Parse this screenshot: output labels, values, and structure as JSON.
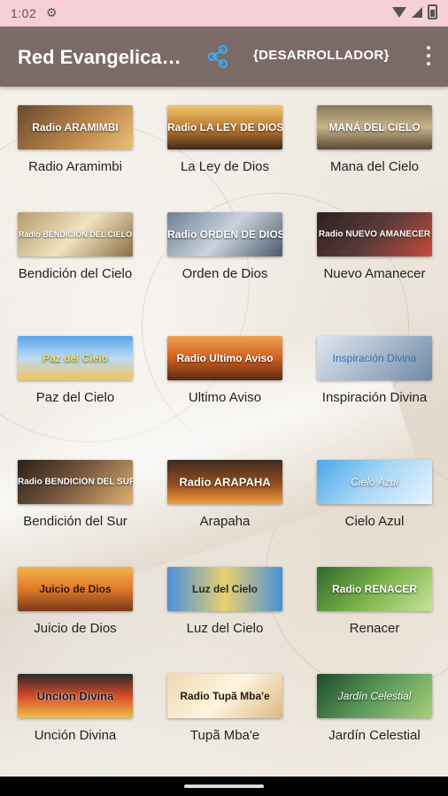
{
  "status_bar": {
    "time": "1:02"
  },
  "app_bar": {
    "title": "Red Evangelica Radial",
    "developer_label": "{DESARROLLADOR}"
  },
  "colors": {
    "app_bar": "#7b6a66",
    "status_bar": "#f6cfd9",
    "share_icon": "#3fa9f5"
  },
  "stations": [
    {
      "name": "Radio Aramimbi",
      "thumb_text": "Radio ARAMIMBI"
    },
    {
      "name": "La Ley de Dios",
      "thumb_text": "Radio LA LEY DE DIOS"
    },
    {
      "name": "Mana del Cielo",
      "thumb_text": "MANÁ DEL CIELO"
    },
    {
      "name": "Bendición del Cielo",
      "thumb_text": "Radio BENDICIÓN DEL CIELO"
    },
    {
      "name": "Orden de Dios",
      "thumb_text": "Radio ORDEN DE DIOS"
    },
    {
      "name": "Nuevo Amanecer",
      "thumb_text": "Radio NUEVO AMANECER"
    },
    {
      "name": "Paz del Cielo",
      "thumb_text": "Paz del Cielo"
    },
    {
      "name": "Ultimo Aviso",
      "thumb_text": "Radio Ultimo Aviso"
    },
    {
      "name": "Inspiración Divina",
      "thumb_text": "Inspiración Divina"
    },
    {
      "name": "Bendición del Sur",
      "thumb_text": "Radio BENDICIÓN DEL SUR"
    },
    {
      "name": "Arapaha",
      "thumb_text": "Radio ARAPAHA"
    },
    {
      "name": "Cielo Azul",
      "thumb_text": "Cielo Azul"
    },
    {
      "name": "Juicio de Dios",
      "thumb_text": "Juicio de Dios"
    },
    {
      "name": "Luz del Cielo",
      "thumb_text": "Luz del Cielo"
    },
    {
      "name": "Renacer",
      "thumb_text": "Radio RENACER"
    },
    {
      "name": "Unción Divina",
      "thumb_text": "Unción Divina"
    },
    {
      "name": "Tupã Mba'e",
      "thumb_text": "Radio Tupã Mba'e"
    },
    {
      "name": "Jardín Celestial",
      "thumb_text": "Jardín Celestial"
    }
  ]
}
